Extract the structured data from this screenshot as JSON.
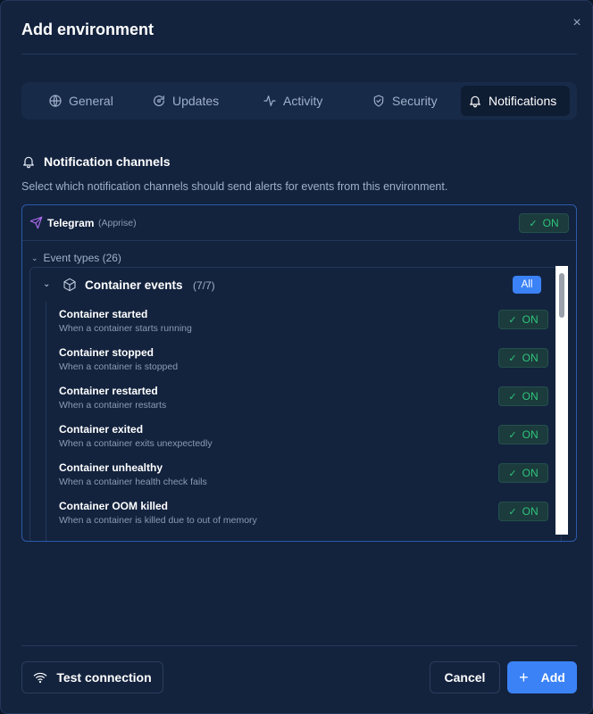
{
  "dialog": {
    "title": "Add environment",
    "close_glyph": "×"
  },
  "tabs": [
    {
      "label": "General",
      "icon": "globe-icon",
      "active": false
    },
    {
      "label": "Updates",
      "icon": "refresh-icon",
      "active": false
    },
    {
      "label": "Activity",
      "icon": "activity-icon",
      "active": false
    },
    {
      "label": "Security",
      "icon": "shield-icon",
      "active": false
    },
    {
      "label": "Notifications",
      "icon": "bell-icon",
      "active": true
    }
  ],
  "notifications": {
    "heading": "Notification channels",
    "description": "Select which notification channels should send alerts for events from this environment.",
    "channel": {
      "name": "Telegram",
      "provider": "(Apprise)",
      "status": "ON",
      "icon": "send-icon"
    },
    "event_types_label": "Event types (26)",
    "group": {
      "title": "Container events",
      "count": "(7/7)",
      "all_label": "All",
      "icon": "box-icon"
    },
    "events": [
      {
        "title": "Container started",
        "desc": "When a container starts running",
        "status": "ON"
      },
      {
        "title": "Container stopped",
        "desc": "When a container is stopped",
        "status": "ON"
      },
      {
        "title": "Container restarted",
        "desc": "When a container restarts",
        "status": "ON"
      },
      {
        "title": "Container exited",
        "desc": "When a container exits unexpectedly",
        "status": "ON"
      },
      {
        "title": "Container unhealthy",
        "desc": "When a container health check fails",
        "status": "ON"
      },
      {
        "title": "Container OOM killed",
        "desc": "When a container is killed due to out of memory",
        "status": "ON"
      }
    ]
  },
  "footer": {
    "test_label": "Test connection",
    "cancel_label": "Cancel",
    "add_label": "Add"
  },
  "colors": {
    "accent": "#3b82f6",
    "on_green": "#2fc47a",
    "telegram_purple": "#b06cf0",
    "background": "#13233e"
  }
}
